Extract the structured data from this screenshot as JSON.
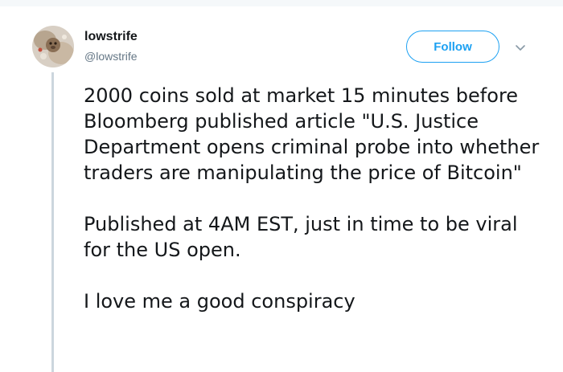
{
  "tweet": {
    "author": {
      "name": "lowstrife",
      "handle": "@lowstrife"
    },
    "follow_label": "Follow",
    "icons": {
      "menu": "chevron-down-icon",
      "avatar": "avatar-image"
    },
    "paragraphs": [
      "2000 coins sold at market 15 minutes before Bloomberg published article \"U.S. Justice Department opens criminal probe into whether traders are manipulating the price of Bitcoin\"",
      "Published at 4AM EST, just in time to be viral for the US open.",
      "I love me a good conspiracy"
    ]
  },
  "colors": {
    "accent": "#1da1f2",
    "text": "#14171a",
    "muted": "#657786",
    "thread": "#ccd6dd"
  }
}
